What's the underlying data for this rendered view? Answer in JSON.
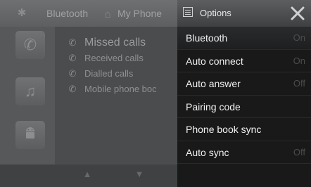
{
  "header": {
    "tabs": [
      {
        "label": "Bluetooth",
        "icon": "home-icon"
      },
      {
        "label": "My Phone"
      }
    ]
  },
  "list": {
    "items": [
      {
        "label": "Missed calls",
        "icon": "missed-call-icon"
      },
      {
        "label": "Received calls",
        "icon": "received-call-icon"
      },
      {
        "label": "Dialled calls",
        "icon": "dialled-call-icon"
      },
      {
        "label": "Mobile phone boc",
        "icon": "phonebook-icon"
      }
    ]
  },
  "options": {
    "title": "Options",
    "items": [
      {
        "label": "Bluetooth",
        "value": "On"
      },
      {
        "label": "Auto connect",
        "value": "On"
      },
      {
        "label": "Auto answer",
        "value": "Off"
      },
      {
        "label": "Pairing code",
        "value": ""
      },
      {
        "label": "Phone book sync",
        "value": ""
      },
      {
        "label": "Auto sync",
        "value": "Off"
      }
    ]
  }
}
